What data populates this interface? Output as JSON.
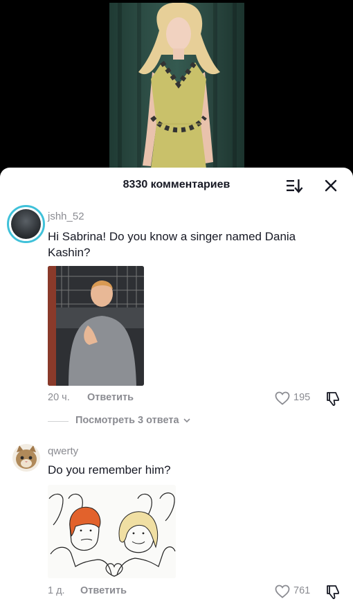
{
  "sheet": {
    "title": "8330 комментариев"
  },
  "comments": [
    {
      "username": "jshh_52",
      "text": "Hi Sabrina! Do you know a singer named Dania Kashin?",
      "time": "20 ч.",
      "reply_label": "Ответить",
      "likes": "195",
      "view_replies": "Посмотреть 3 ответа"
    },
    {
      "username": "qwerty",
      "text": "Do you remember him?",
      "time": "1 д.",
      "reply_label": "Ответить",
      "likes": "761"
    }
  ],
  "icons": {
    "sort": "sort-icon",
    "close": "close-icon",
    "like": "heart-outline-icon",
    "dislike": "thumb-down-icon",
    "chevron": "chevron-down-icon"
  },
  "colors": {
    "avatar_ring": "#3fc1d9",
    "muted_text": "#8a8b91",
    "primary_text": "#161823"
  }
}
